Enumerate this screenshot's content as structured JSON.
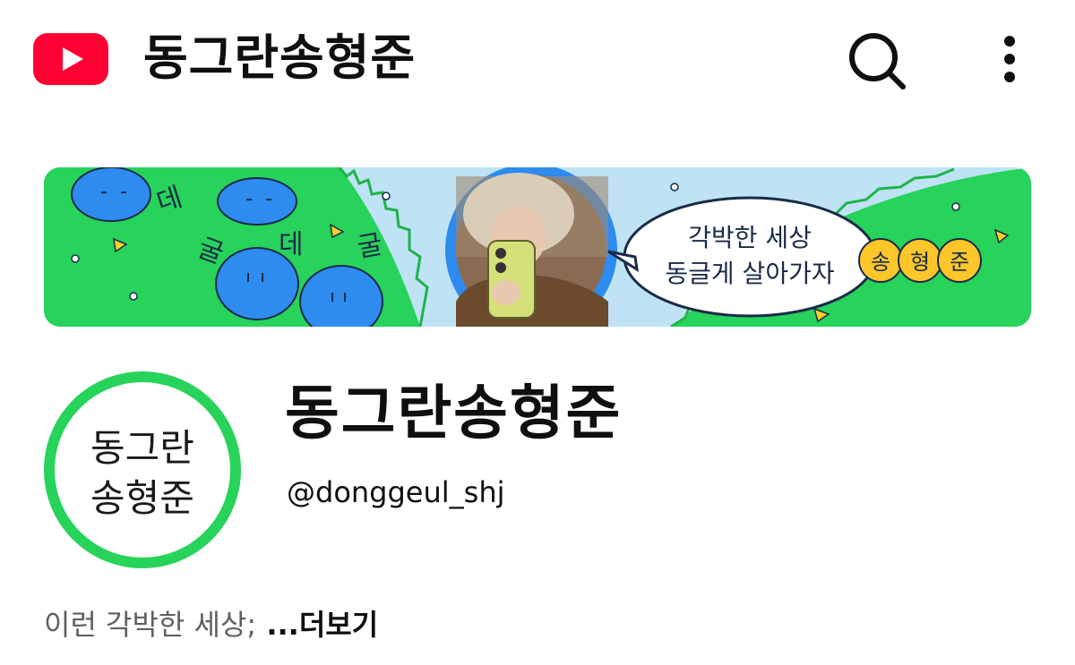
{
  "header": {
    "logo_icon": "youtube-logo-icon",
    "title": "동그란송형준",
    "search_icon": "search-icon",
    "more_icon": "more-vert-icon"
  },
  "banner": {
    "side_text": [
      "데",
      "굴",
      "데",
      "굴"
    ],
    "bubble_line1": "각박한 세상",
    "bubble_line2": "동글게 살아가자",
    "name_coins": [
      "송",
      "형",
      "준"
    ]
  },
  "channel": {
    "avatar_line1": "동그란",
    "avatar_line2": "송형준",
    "name": "동그란송형준",
    "handle": "@donggeul_shj",
    "description": "이런 각박한 세상;",
    "more_label": " ...더보기"
  },
  "colors": {
    "youtube_red": "#ff0033",
    "banner_green": "#27d35a",
    "banner_sky": "#bfe3f5",
    "blob_blue": "#2e8bf0",
    "coin_yellow": "#ffc629",
    "text_primary": "#0f0f0f",
    "text_secondary": "#606060"
  }
}
